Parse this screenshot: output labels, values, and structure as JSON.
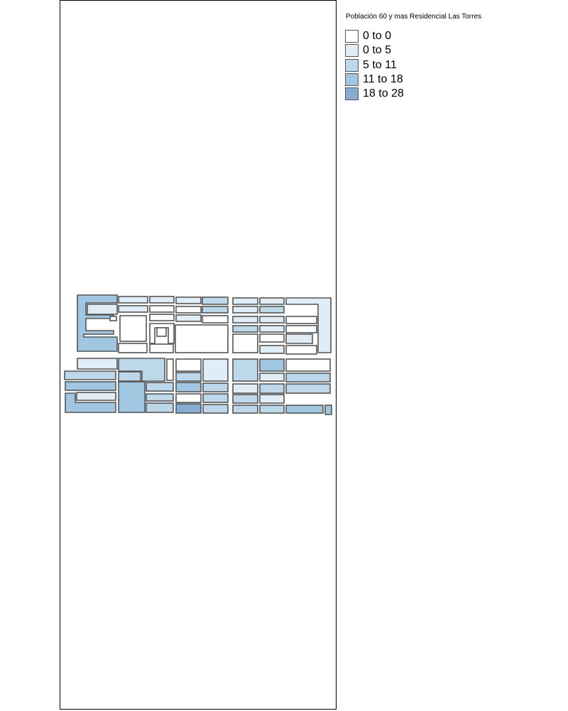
{
  "legend": {
    "title": "Población 60 y mas Residencial Las Torres",
    "classes": [
      {
        "label": "0 to 0",
        "color": "#ffffff"
      },
      {
        "label": "0 to 5",
        "color": "#e1edf6"
      },
      {
        "label": "5 to 11",
        "color": "#bcd8ea"
      },
      {
        "label": "11 to 18",
        "color": "#a1c6e2"
      },
      {
        "label": "18 to 28",
        "color": "#86acd1"
      }
    ]
  },
  "style": {
    "block_stroke": "#555555"
  },
  "blocks": [
    {
      "class": 3
    },
    {
      "class": 1
    },
    {
      "class": 1
    },
    {
      "class": 1
    },
    {
      "class": 2
    },
    {
      "class": 1
    },
    {
      "class": 1
    },
    {
      "class": 1
    },
    {
      "class": 1
    },
    {
      "class": 1
    },
    {
      "class": 0
    },
    {
      "class": 0
    },
    {
      "class": 2
    },
    {
      "class": 1
    },
    {
      "class": 2
    },
    {
      "class": 0
    },
    {
      "class": 1
    },
    {
      "class": 0
    },
    {
      "class": 0
    },
    {
      "class": 1
    },
    {
      "class": 1
    },
    {
      "class": 0
    },
    {
      "class": 0
    },
    {
      "class": 0
    },
    {
      "class": 0
    },
    {
      "class": 2
    },
    {
      "class": 1
    },
    {
      "class": 0
    },
    {
      "class": 0
    },
    {
      "class": 0
    },
    {
      "class": 0
    },
    {
      "class": 0
    },
    {
      "class": 1
    },
    {
      "class": 0
    },
    {
      "class": 1
    },
    {
      "class": 0
    },
    {
      "class": 1
    },
    {
      "class": 2
    },
    {
      "class": 3
    },
    {
      "class": 0
    },
    {
      "class": 2
    },
    {
      "class": 0
    },
    {
      "class": 0
    },
    {
      "class": 1
    },
    {
      "class": 2
    },
    {
      "class": 2
    },
    {
      "class": 2
    },
    {
      "class": 1
    },
    {
      "class": 2
    },
    {
      "class": 3
    },
    {
      "class": 3
    },
    {
      "class": 2
    },
    {
      "class": 3
    },
    {
      "class": 2
    },
    {
      "class": 1
    },
    {
      "class": 2
    },
    {
      "class": 2
    },
    {
      "class": 1
    },
    {
      "class": 2
    },
    {
      "class": 0
    },
    {
      "class": 2
    },
    {
      "class": 2
    },
    {
      "class": 1
    },
    {
      "class": 3
    },
    {
      "class": 2
    },
    {
      "class": 4
    },
    {
      "class": 2
    },
    {
      "class": 2
    },
    {
      "class": 2
    },
    {
      "class": 3
    },
    {
      "class": 3
    },
    {
      "class": 3
    },
    {
      "class": 0
    }
  ]
}
